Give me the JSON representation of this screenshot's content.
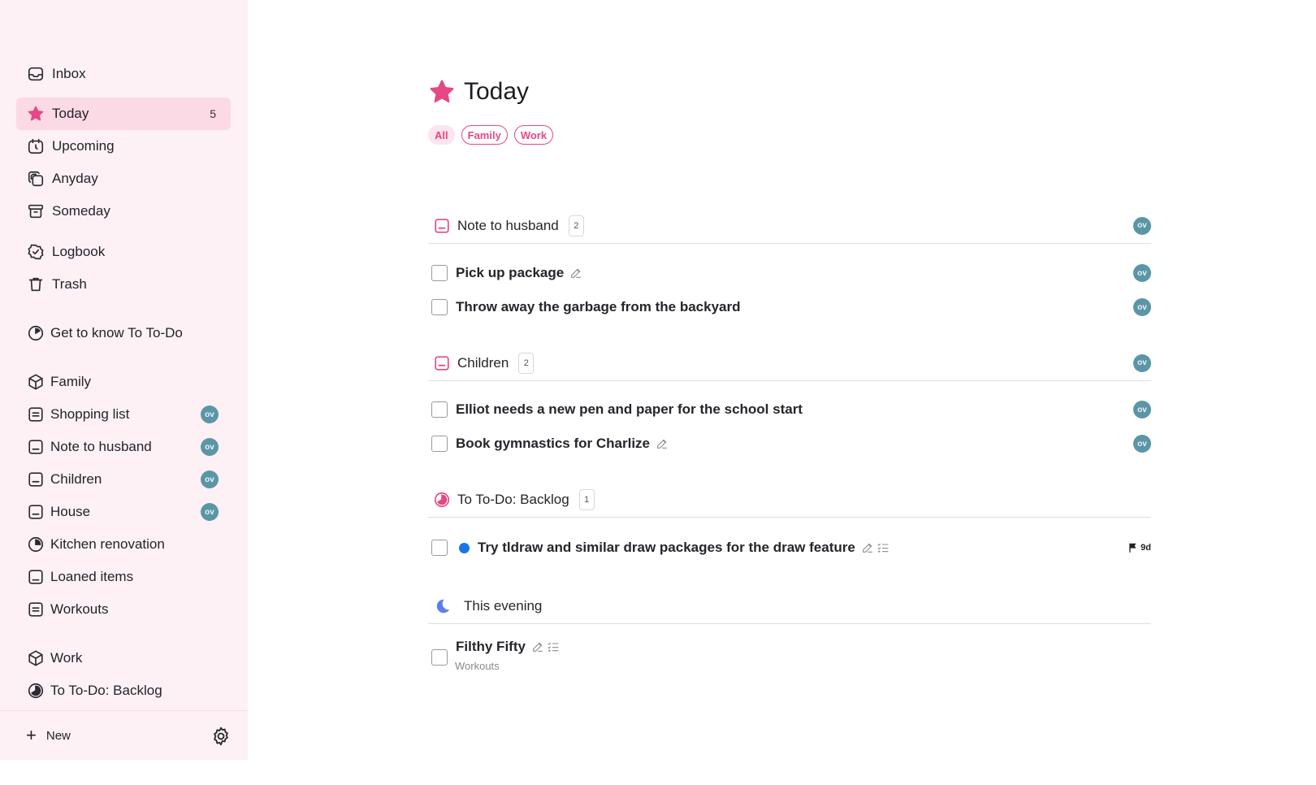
{
  "sidebar": {
    "nav": [
      {
        "label": "Inbox"
      },
      {
        "label": "Today",
        "count": "5"
      },
      {
        "label": "Upcoming"
      },
      {
        "label": "Anyday"
      },
      {
        "label": "Someday"
      },
      {
        "label": "Logbook"
      },
      {
        "label": "Trash"
      }
    ],
    "get_to_know": "Get to know To To-Do",
    "areas": [
      {
        "label": "Family"
      },
      {
        "label": "Shopping list",
        "avatar": "ov"
      },
      {
        "label": "Note to husband",
        "avatar": "ov"
      },
      {
        "label": "Children",
        "avatar": "ov"
      },
      {
        "label": "House",
        "avatar": "ov"
      },
      {
        "label": "Kitchen renovation"
      },
      {
        "label": "Loaned items"
      },
      {
        "label": "Workouts"
      },
      {
        "label": "Work"
      },
      {
        "label": "To To-Do: Backlog"
      }
    ],
    "new_label": "New"
  },
  "main": {
    "title": "Today",
    "tags": [
      "All",
      "Family",
      "Work"
    ],
    "groups": [
      {
        "label": "Note to husband",
        "count": "2",
        "avatar": "ov",
        "tasks": [
          {
            "title": "Pick up package",
            "avatar": "ov"
          },
          {
            "title": "Throw away the garbage from the backyard",
            "avatar": "ov"
          }
        ]
      },
      {
        "label": "Children",
        "count": "2",
        "avatar": "ov",
        "tasks": [
          {
            "title": "Elliot needs a new pen and paper for the school start",
            "avatar": "ov"
          },
          {
            "title": "Book gymnastics for Charlize",
            "avatar": "ov"
          }
        ]
      },
      {
        "label": "To To-Do: Backlog",
        "count": "1",
        "tasks": [
          {
            "title": "Try tldraw and similar draw packages for the draw feature",
            "deadline": "9d"
          }
        ]
      },
      {
        "label": "This evening",
        "tasks": [
          {
            "title": "Filthy Fifty",
            "project": "Workouts"
          }
        ]
      }
    ]
  },
  "colors": {
    "accent": "#e64785",
    "sidebar_bg": "#fdf1f5",
    "active_bg": "#fbd9e5",
    "avatar": "#5b96a6",
    "dot": "#1976e8"
  }
}
